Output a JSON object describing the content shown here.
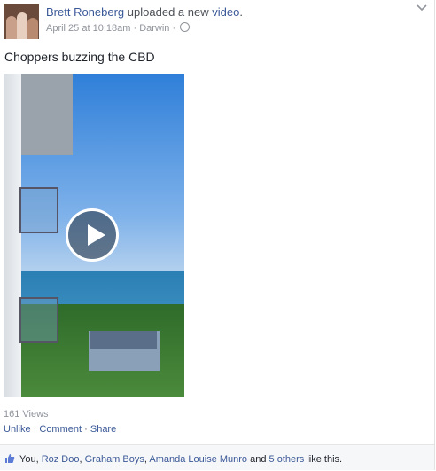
{
  "post": {
    "author": "Brett Roneberg",
    "action_text": "uploaded a new",
    "object_link": "video",
    "object_suffix": ".",
    "date": "April 25 at 10:18am",
    "location": "Darwin",
    "message": "Choppers buzzing the CBD",
    "views": "161 Views"
  },
  "actions": {
    "unlike": "Unlike",
    "comment": "Comment",
    "share": "Share",
    "sep": "·"
  },
  "likes": {
    "prefix": "You,",
    "names": [
      "Roz Doo",
      "Graham Boys",
      "Amanda Louise Munro"
    ],
    "and": "and",
    "others": "5 others",
    "suffix": "like this."
  },
  "icons": {
    "privacy": "globe-icon",
    "menu": "chevron-down-icon",
    "like": "thumbs-up-icon",
    "play": "play-icon"
  },
  "colors": {
    "link": "#3b5998",
    "meta": "#90949c",
    "text": "#1d2129"
  }
}
